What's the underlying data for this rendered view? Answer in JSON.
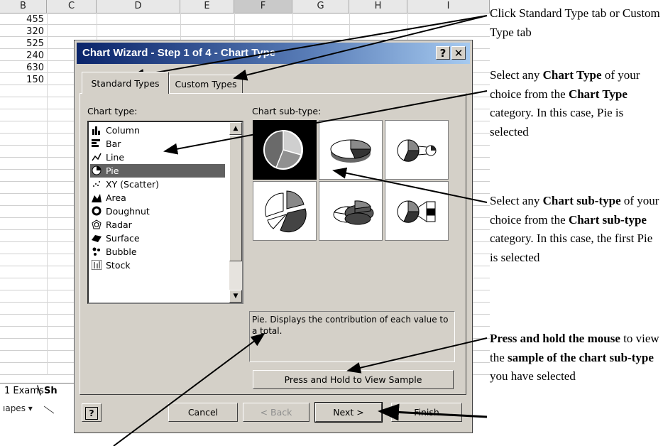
{
  "sheet": {
    "columns": [
      "B",
      "C",
      "D",
      "E",
      "F",
      "G",
      "H",
      "I"
    ],
    "selected_column": "F",
    "b_values": [
      "455",
      "320",
      "525",
      "240",
      "630",
      "150"
    ],
    "tabs": {
      "first": "1 Exams",
      "second": "Sh"
    },
    "draw_toolbar": {
      "shapes_label": "ıapes ▾"
    }
  },
  "dialog": {
    "title": "Chart Wizard - Step 1 of 4 - Chart Type",
    "help_button": "?",
    "close_button": "✕",
    "tabs": [
      "Standard Types",
      "Custom Types"
    ],
    "chart_type_label": "Chart type:",
    "chart_subtype_label": "Chart sub-type:",
    "chart_types": [
      "Column",
      "Bar",
      "Line",
      "Pie",
      "XY (Scatter)",
      "Area",
      "Doughnut",
      "Radar",
      "Surface",
      "Bubble",
      "Stock"
    ],
    "selected_type": "Pie",
    "description": "Pie. Displays the contribution of each value to a total.",
    "sample_button": "Press and Hold to View Sample",
    "buttons": {
      "help": "?",
      "cancel": "Cancel",
      "back": "< Back",
      "next": "Next >",
      "finish": "Finish"
    }
  },
  "annotations": {
    "a1": "Click Standard Type tab or Custom Type tab",
    "a2_pre": "Select any ",
    "a2_b1": "Chart Type",
    "a2_mid": " of your choice from the ",
    "a2_b2": "Chart Type",
    "a2_post": " category. In this case, Pie is selected",
    "a3_pre": "Select any ",
    "a3_b1": "Chart sub-type",
    "a3_mid": " of your choice from the ",
    "a3_b2": "Chart sub-type",
    "a3_post": " category. In this case, the first Pie is selected",
    "a4_b1": "Press and hold the mouse",
    "a4_mid": " to view the ",
    "a4_b2": "sample of the chart sub-type",
    "a4_post": " you have selected"
  }
}
